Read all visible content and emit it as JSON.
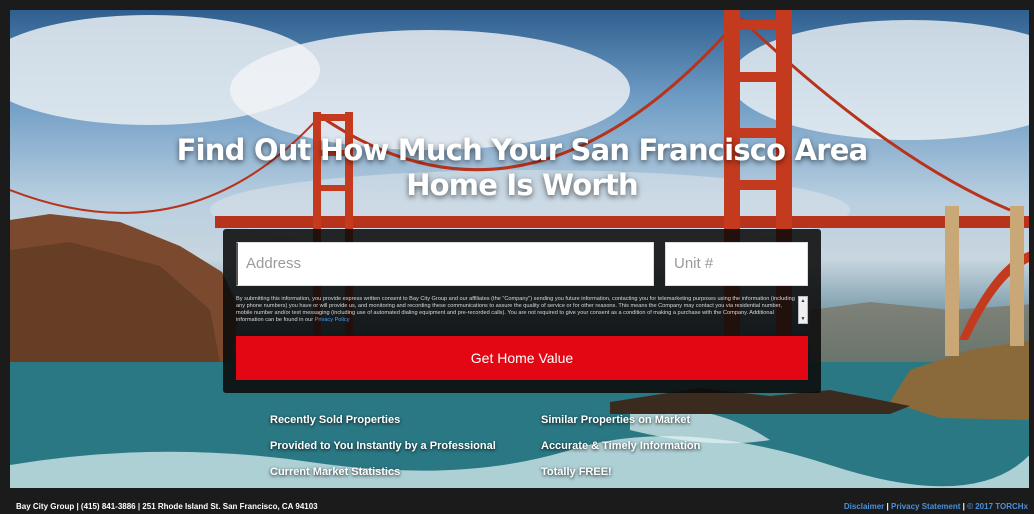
{
  "hero": {
    "headline": "Find Out How Much Your San Francisco Area Home Is Worth"
  },
  "form": {
    "address_placeholder": "Address",
    "unit_placeholder": "Unit #",
    "consent_text": "By submitting this information, you provide express written consent to Bay City Group and our affiliates (the \"Company\") sending you future information, contacting you for telemarketing purposes using the information (including any phone numbers) you have or will provide us, and monitoring and recording these communications to assure the quality of service or for other reasons. This means the Company may contact you via residential number, mobile number and/or text messaging (including use of automated dialing equipment and pre-recorded calls). You are not required to give your consent as a condition of making a purchase with the Company. Additional information can be found in our",
    "consent_link": "Privacy Policy",
    "submit_label": "Get Home Value"
  },
  "benefits": {
    "left": [
      "Recently Sold Properties",
      "Provided to You Instantly by a Professional",
      "Current Market Statistics"
    ],
    "right": [
      "Similar Properties on Market",
      "Accurate & Timely Information",
      "Totally FREE!"
    ]
  },
  "footer": {
    "contact": "Bay City Group | (415) 841-3886 | 251 Rhode Island St. San Francisco, CA 94103",
    "disclaimer": "Disclaimer",
    "privacy": "Privacy Statement",
    "copyright": "© 2017 TORCHx",
    "separator": "|"
  },
  "colors": {
    "accent": "#e30613",
    "link": "#4a90d9",
    "bridge": "#c43a1e"
  }
}
